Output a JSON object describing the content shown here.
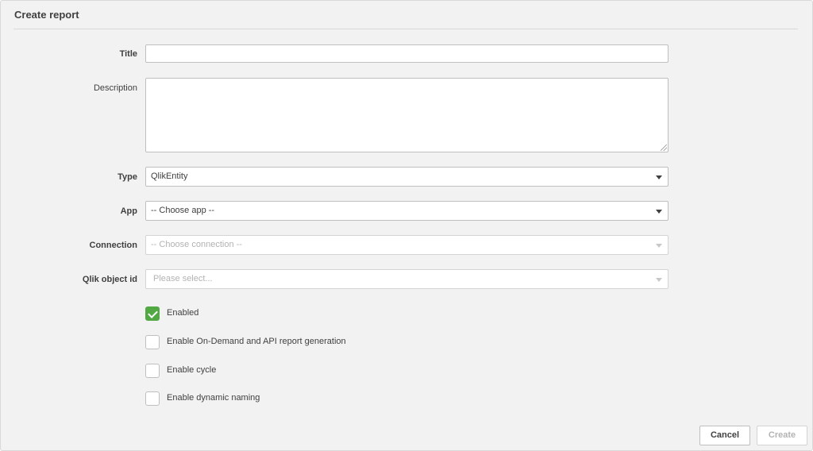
{
  "dialog": {
    "title": "Create report"
  },
  "form": {
    "title_label": "Title",
    "title_value": "",
    "description_label": "Description",
    "description_value": "",
    "type_label": "Type",
    "type_value": "QlikEntity",
    "app_label": "App",
    "app_value": "-- Choose app --",
    "connection_label": "Connection",
    "connection_value": "-- Choose connection --",
    "object_label": "Qlik object id",
    "object_placeholder": "Please select..."
  },
  "options": [
    {
      "label": "Enabled",
      "checked": true
    },
    {
      "label": "Enable On-Demand and API report generation",
      "checked": false
    },
    {
      "label": "Enable cycle",
      "checked": false
    },
    {
      "label": "Enable dynamic naming",
      "checked": false
    }
  ],
  "buttons": {
    "cancel": "Cancel",
    "create": "Create"
  },
  "colors": {
    "accent_green": "#52a843",
    "panel_bg": "#f2f2f2",
    "border": "#bfbfbf"
  }
}
